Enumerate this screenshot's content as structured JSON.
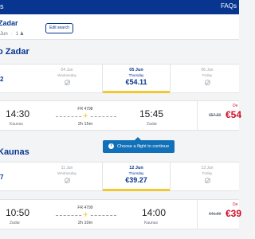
{
  "topbar": {
    "left_fragment": "s",
    "faqs": "FAQs"
  },
  "search": {
    "route_fragment": "Zadar",
    "date_fragment": "Jun",
    "passengers": "1",
    "edit_label": "Edit search"
  },
  "outbound": {
    "title_fragment": "Zadar",
    "edge_price": "2",
    "dates": [
      {
        "date": "04 Jun",
        "weekday": "Wednesday",
        "available": false
      },
      {
        "date": "05 Jun",
        "weekday": "Thursday",
        "price": "€54.11",
        "selected": true
      },
      {
        "date": "06 Jun",
        "weekday": "Friday",
        "available": false
      }
    ],
    "flight": {
      "departure_time": "14:30",
      "departure_city": "Kaunas",
      "flight_number": "FR 4798",
      "duration": "2h 15m",
      "arrival_time": "15:45",
      "arrival_city": "Zadar",
      "old_price": "€57.99",
      "new_price": "€54",
      "deal_fragment": "De"
    }
  },
  "tooltip": {
    "text": "Choose a flight to continue"
  },
  "return": {
    "title_fragment": "Kaunas",
    "edge_price": "7",
    "dates": [
      {
        "date": "11 Jun",
        "weekday": "Wednesday",
        "available": false
      },
      {
        "date": "12 Jun",
        "weekday": "Thursday",
        "price": "€39.27",
        "selected": true
      },
      {
        "date": "13 Jun",
        "weekday": "Friday",
        "available": false
      }
    ],
    "flight": {
      "departure_time": "10:50",
      "departure_city": "Zadar",
      "flight_number": "FR 4799",
      "duration": "2h 10m",
      "arrival_time": "14:00",
      "arrival_city": "Kaunas",
      "old_price": "€41.99",
      "new_price": "€39",
      "deal_fragment": "De"
    }
  },
  "colors": {
    "brand": "#073590",
    "accent": "#f1c933",
    "deal": "#d0102b",
    "info": "#1170b8"
  }
}
